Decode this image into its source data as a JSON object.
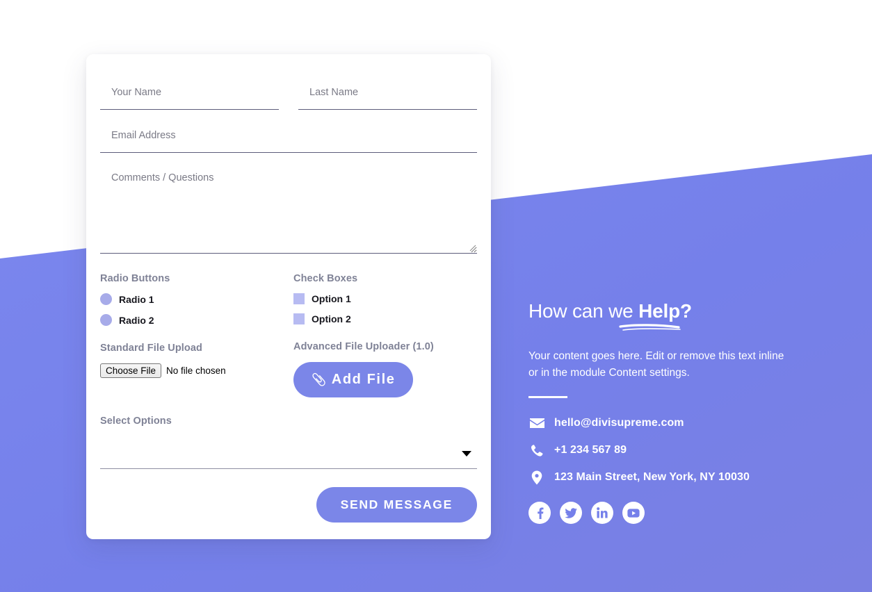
{
  "theme": {
    "background_purple": "#7580ea",
    "background_purple_alt": "#7d83e4",
    "button_purple": "#7b86e8",
    "radio_fill": "#a7abe9",
    "checkbox_fill": "#b7bbf2",
    "card_white": "#ffffff",
    "label_gray": "#7f8296",
    "input_underline": "#5b5b7a"
  },
  "form": {
    "fields": {
      "first_name": {
        "placeholder": "Your Name",
        "value": ""
      },
      "last_name": {
        "placeholder": "Last Name",
        "value": ""
      },
      "email": {
        "placeholder": "Email Address",
        "value": ""
      },
      "comments": {
        "placeholder": "Comments / Questions",
        "value": ""
      }
    },
    "radio_group": {
      "label": "Radio Buttons",
      "options": [
        {
          "label": "Radio 1",
          "checked": false
        },
        {
          "label": "Radio 2",
          "checked": false
        }
      ]
    },
    "checkbox_group": {
      "label": "Check Boxes",
      "options": [
        {
          "label": "Option 1",
          "checked": false
        },
        {
          "label": "Option 2",
          "checked": false
        }
      ]
    },
    "standard_upload": {
      "label": "Standard File Upload",
      "button_label": "Choose File",
      "status": "No file chosen"
    },
    "advanced_upload": {
      "label": "Advanced File Uploader (1.0)",
      "button_label": "Add File",
      "button_icon": "paperclip-icon"
    },
    "select": {
      "label": "Select Options",
      "selected": "",
      "options": [
        ""
      ]
    },
    "submit": {
      "label": "SEND MESSAGE"
    }
  },
  "panel": {
    "heading_light": "How can we ",
    "heading_strong": "Help?",
    "body": "Your content goes here. Edit or remove this text inline or in the module Content settings.",
    "contacts": [
      {
        "icon": "envelope-icon",
        "text": "hello@divisupreme.com"
      },
      {
        "icon": "phone-icon",
        "text": "+1 234 567 89"
      },
      {
        "icon": "map-pin-icon",
        "text": "123 Main Street, New York, NY 10030"
      }
    ],
    "social": [
      {
        "icon": "facebook-icon",
        "name": "Facebook"
      },
      {
        "icon": "twitter-icon",
        "name": "Twitter"
      },
      {
        "icon": "linkedin-icon",
        "name": "LinkedIn"
      },
      {
        "icon": "youtube-icon",
        "name": "YouTube"
      }
    ]
  }
}
